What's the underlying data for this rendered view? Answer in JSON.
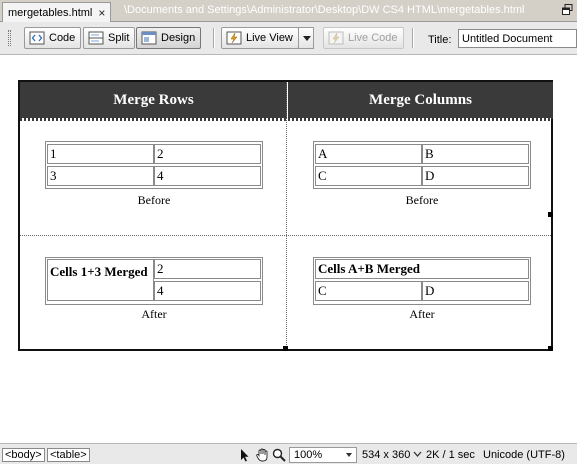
{
  "document_tab": {
    "filename": "mergetables.html",
    "close": "×",
    "path": "\\Documents and Settings\\Administrator\\Desktop\\DW CS4 HTML\\mergetables.html"
  },
  "toolbar": {
    "code_label": "Code",
    "split_label": "Split",
    "design_label": "Design",
    "live_view_label": "Live View",
    "live_code_label": "Live Code",
    "title_label": "Title:",
    "title_value": "Untitled Document"
  },
  "page": {
    "headers": {
      "rows": "Merge Rows",
      "columns": "Merge Columns"
    },
    "before_rows": {
      "cells": [
        [
          "1",
          "2"
        ],
        [
          "3",
          "4"
        ]
      ],
      "caption": "Before"
    },
    "before_cols": {
      "cells": [
        [
          "A",
          "B"
        ],
        [
          "C",
          "D"
        ]
      ],
      "caption": "Before"
    },
    "after_rows": {
      "merged": "Cells 1+3 Merged",
      "cell_2": "2",
      "cell_4": "4",
      "caption": "After"
    },
    "after_cols": {
      "merged": "Cells A+B Merged",
      "cell_c": "C",
      "cell_d": "D",
      "caption": "After"
    }
  },
  "status_bar": {
    "tags": [
      "<body>",
      "<table>"
    ],
    "zoom": "100%",
    "window_size": "534 x 360",
    "download": "2K / 1 sec",
    "encoding": "Unicode (UTF-8)"
  },
  "colors": {
    "header_bg": "#3a3a3a",
    "tabbar_bg": "#d4d0c8",
    "toolbar_bg": "#e9e9e9"
  }
}
